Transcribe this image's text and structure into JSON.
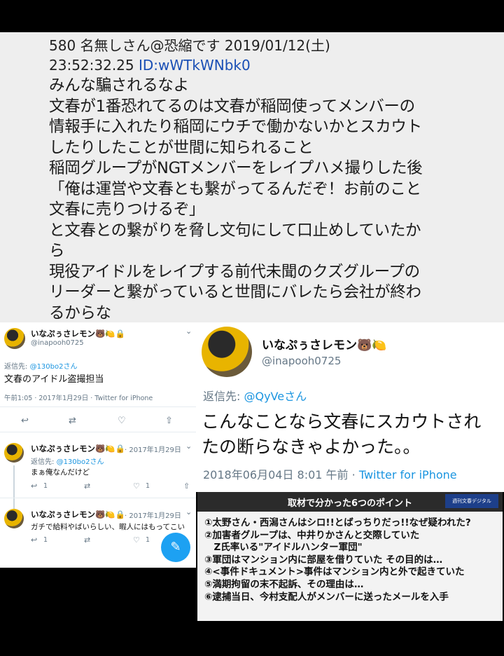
{
  "post": {
    "header_line1": "580 名無しさん@恐縮です 2019/01/12(土)",
    "header_time": "23:52:32.25",
    "header_id": "ID:wWTkWNbk0",
    "body_lines": [
      "みんな騙されるなよ",
      "文春が1番恐れてるのは文春が稲岡使ってメンバーの",
      "情報手に入れたり稲岡にウチで働かないかとスカウト",
      "したりしたことが世間に知られること",
      "稲岡グループがNGTメンバーをレイプハメ撮りした後",
      "「俺は運営や文春とも繋がってるんだぞ！お前のこと",
      "文春に売りつけるぞ」",
      "と文春との繋がりを脅し文句にして口止めしていたか",
      "ら",
      "現役アイドルをレイプする前代未聞のクズグループの",
      "リーダーと繋がっていると世間にバレたら会社が終わ",
      "るからな"
    ]
  },
  "left_panel": {
    "main_tweet": {
      "name": "いなぷぅさレモン🐻🍋🔒",
      "handle": "@inapooh0725",
      "reply_label": "返信先: ",
      "reply_to": "@130bo2さん",
      "text": "文春のアイドル盗撮担当",
      "meta": "午前1:05 · 2017年1月29日 · Twitter for iPhone",
      "icons": {
        "reply": "↩",
        "retweet": "⇄",
        "like": "♡",
        "share": "⇧"
      }
    },
    "reply1": {
      "name": "いなぷぅさレモン🐻🍋🔒",
      "date": "· 2017年1月29日",
      "reply_label": "返信先: ",
      "reply_to": "@130bo2さん",
      "text": "まぁ俺なんだけど",
      "reply_count": "1",
      "like_count": "1"
    },
    "reply2": {
      "name": "いなぷぅさレモン🐻🍋🔒",
      "date": "· 2017年1月29日",
      "text": "ガチで給料やばいらしい、暇人にはもってこい",
      "reply_count": "1",
      "like_count": "1"
    },
    "fab_icon": "compose-icon"
  },
  "right_panel": {
    "name": "いなぷぅさレモン🐻🍋",
    "handle": "@inapooh0725",
    "reply_label": "返信先: ",
    "reply_to": "@QyVeさん",
    "text_line1": "こんなことなら文春にスカウトされ",
    "text_line2": "たの断らなきゃよかった。。",
    "meta_date": "2018年06月04日 8:01 午前 · ",
    "meta_source": "Twitter for iPhone"
  },
  "news": {
    "title": "取材で分かった6つのポイント",
    "logo": "週刊文春デジタル",
    "points": [
      "①太野さん・西潟さんはシロ!!とばっちりだっ!!なぜ疑われた?",
      "②加害者グループは、中井りかさんと交際していた",
      "　Z氏率いる\"アイドルハンター軍団\"",
      "③軍団はマンション内に部屋を借りていた その目的は…",
      "④<事件ドキュメント>事件はマンション内と外で起きていた",
      "⑤満期拘留の末不起訴、その理由は…",
      "⑥逮捕当日、今村支配人がメンバーに送ったメールを入手"
    ]
  }
}
